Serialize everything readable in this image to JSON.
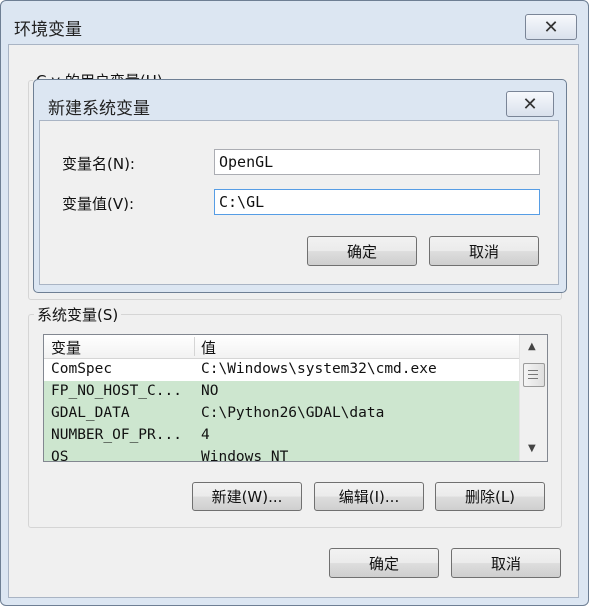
{
  "outer_dialog": {
    "title": "环境变量",
    "user_group_label": "C y 的用户变量(U)",
    "system_group_label": "系统变量(S)",
    "columns": [
      "变量",
      "值"
    ],
    "rows": [
      {
        "name": "ComSpec",
        "value": "C:\\Windows\\system32\\cmd.exe",
        "highlight": false
      },
      {
        "name": "FP_NO_HOST_C...",
        "value": "NO",
        "highlight": true
      },
      {
        "name": "GDAL_DATA",
        "value": "C:\\Python26\\GDAL\\data",
        "highlight": true
      },
      {
        "name": "NUMBER_OF_PR...",
        "value": "4",
        "highlight": true
      },
      {
        "name": "OS",
        "value": "Windows_NT",
        "highlight": true
      }
    ],
    "new_button": "新建(W)...",
    "edit_button": "编辑(I)...",
    "delete_button": "删除(L)",
    "ok_button": "确定",
    "cancel_button": "取消"
  },
  "inner_dialog": {
    "title": "新建系统变量",
    "name_label": "变量名(N):",
    "name_value": "OpenGL",
    "value_label": "变量值(V):",
    "value_value": "C:\\GL",
    "ok_button": "确定",
    "cancel_button": "取消"
  },
  "icons": {
    "close": "✕",
    "scroll_up": "▲",
    "scroll_down": "▼"
  },
  "colors": {
    "frame": "#dce6f2",
    "client": "#f0f0f0",
    "selection": "#cde6cf"
  }
}
